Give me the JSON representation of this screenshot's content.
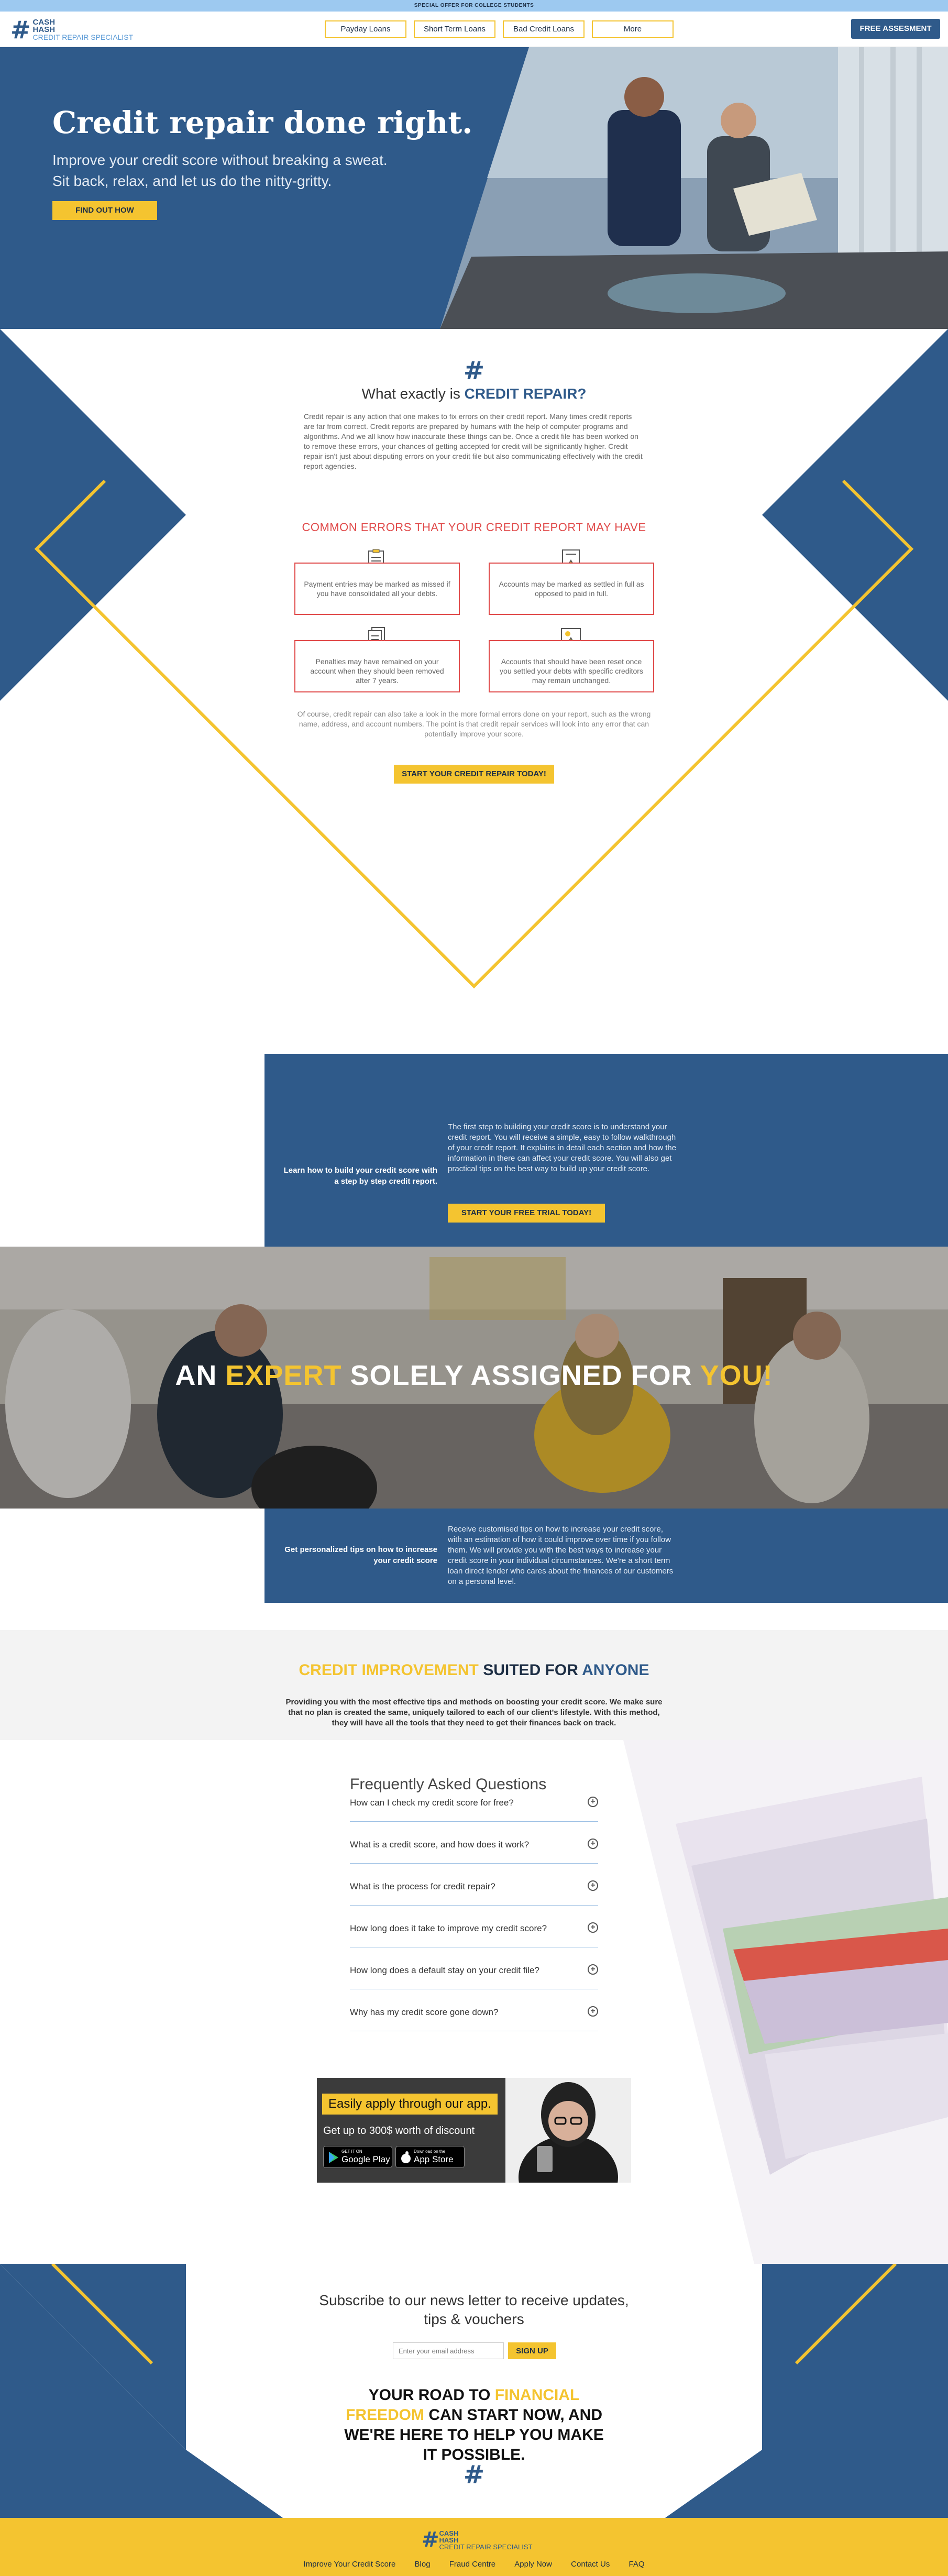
{
  "promo": "SPECIAL OFFER FOR COLLEGE STUDENTS",
  "logo": {
    "line1": "CASH",
    "line2": "HASH",
    "line3": "CREDIT REPAIR SPECIALIST"
  },
  "nav": [
    "Payday Loans",
    "Short Term Loans",
    "Bad Credit Loans",
    "More"
  ],
  "header_cta": "FREE ASSESMENT",
  "hero": {
    "title": "Credit repair done right.",
    "line1": "Improve your credit score without breaking a sweat.",
    "line2": "Sit back, relax, and let us do the nitty-gritty.",
    "button": "FIND OUT HOW"
  },
  "what": {
    "icon": "#",
    "title_prefix": "What exactly is",
    "title_highlight": "CREDIT REPAIR?",
    "body": "Credit repair is any action that one makes to fix errors on their credit report. Many times credit reports are far from correct. Credit reports are prepared by humans with the help of computer programs and algorithms. And we all know how inaccurate these things can be. Once a credit file has been worked on to remove these errors, your chances of getting accepted for credit will be significantly higher. Credit repair isn't just about disputing errors on your credit file but also communicating effectively with the credit report agencies."
  },
  "errors": {
    "title": "COMMON ERRORS THAT YOUR CREDIT REPORT MAY HAVE",
    "items": [
      "Payment entries may be marked as missed if you have consolidated all your debts.",
      "Accounts may be marked as settled in full as opposed to paid in full.",
      "Penalties may have remained on your account when they should been removed after 7 years.",
      "Accounts that should have been reset once you settled your debts with specific creditors may remain unchanged."
    ],
    "note": "Of course, credit repair can also take a look in the more formal errors done on your report, such as the wrong name, address, and account numbers. The point is that credit repair services will look into any error that can potentially improve your score.",
    "button": "START YOUR CREDIT REPAIR TODAY!"
  },
  "learn": {
    "lead": "Learn how to build your credit score with a step by step credit report.",
    "text": "The first step to building your credit score is to understand your credit report. You will receive a simple, easy to follow walkthrough of your credit report. It explains in detail each section and how the information in there can affect your credit score. You will also get practical tips on the best way to build up your credit score.",
    "button": "START YOUR FREE TRIAL TODAY!"
  },
  "expert": {
    "w1": "AN",
    "w2": "EXPERT",
    "w3": "SOLELY ASSIGNED FOR",
    "w4": "YOU!"
  },
  "tips": {
    "lead": "Get personalized tips on how to increase your credit score",
    "text": "Receive customised tips on how to increase your credit score, with an estimation of how it could improve over time if you follow them. We will provide you with the best ways to increase your credit score in your individual circumstances. We're a short term loan direct lender who cares about the finances of our customers on a personal level."
  },
  "improve": {
    "h1": "CREDIT IMPROVEMENT",
    "h2": "SUITED FOR",
    "h3": "ANYONE",
    "text": "Providing you with the most effective tips and methods on boosting your credit score. We make sure that no plan is created the same, uniquely tailored to each of our client's lifestyle. With this method, they will have all the tools that they need to get their finances back on track."
  },
  "faq": {
    "title": "Frequently Asked Questions",
    "items": [
      "How can I check my credit score for free?",
      "What is a credit score, and how does it work?",
      "What is the process for credit repair?",
      "How long does it take to improve my credit score?",
      "How long does a default stay on your credit file?",
      "Why has my credit score gone down?"
    ]
  },
  "app": {
    "title": "Easily apply through our app.",
    "sub": "Get up to 300$ worth of discount",
    "google_small": "GET IT ON",
    "google_big": "Google Play",
    "apple_small": "Download on the",
    "apple_big": "App Store"
  },
  "news": {
    "title": "Subscribe to our news letter to receive updates, tips & vouchers",
    "placeholder": "Enter your email address",
    "button": "SIGN UP"
  },
  "road": {
    "a": "YOUR ROAD TO",
    "b": "FINANCIAL FREEDOM",
    "c": "CAN START NOW, AND WE'RE HERE TO HELP YOU MAKE IT POSSIBLE.",
    "icon": "#"
  },
  "footer": {
    "links": [
      "Improve Your Credit Score",
      "Blog",
      "Fraud Centre",
      "Apply Now",
      "Contact Us",
      "FAQ"
    ]
  },
  "colors": {
    "brand_blue": "#2f5a8a",
    "accent_yellow": "#f4c430",
    "error_red": "#e04a4a"
  }
}
